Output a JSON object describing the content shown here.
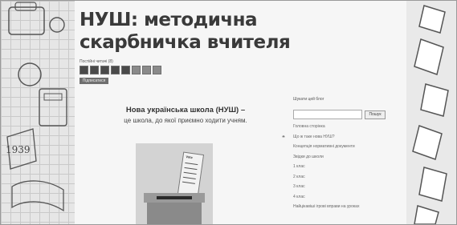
{
  "site": {
    "title": "НУШ: методична скарбничка вчителя"
  },
  "followers": {
    "label": "Постійні читачі (8)",
    "count": 8,
    "button": "Підписатися"
  },
  "post": {
    "title": "Нова українська школа (НУШ) –",
    "subtitle": "це школа, до якої приємно ходити учням.",
    "image": {
      "ballot_label": "Vote"
    }
  },
  "sidebar": {
    "search_label": "Шукати цей блог",
    "search_value": "",
    "search_button": "Пошук",
    "links": [
      "Головна сторінка",
      "Що ж таке нова НУШ?",
      "Концепція нормативні документи",
      "Звідки до школи",
      "1 клас",
      "2 клас",
      "3 клас",
      "4 клас",
      "Найцікавіші ігрові вправи на уроках"
    ]
  },
  "colors": {
    "page_bg": "#f6f6f6",
    "title": "#3a3a3a",
    "button": "#6f6f6f"
  }
}
